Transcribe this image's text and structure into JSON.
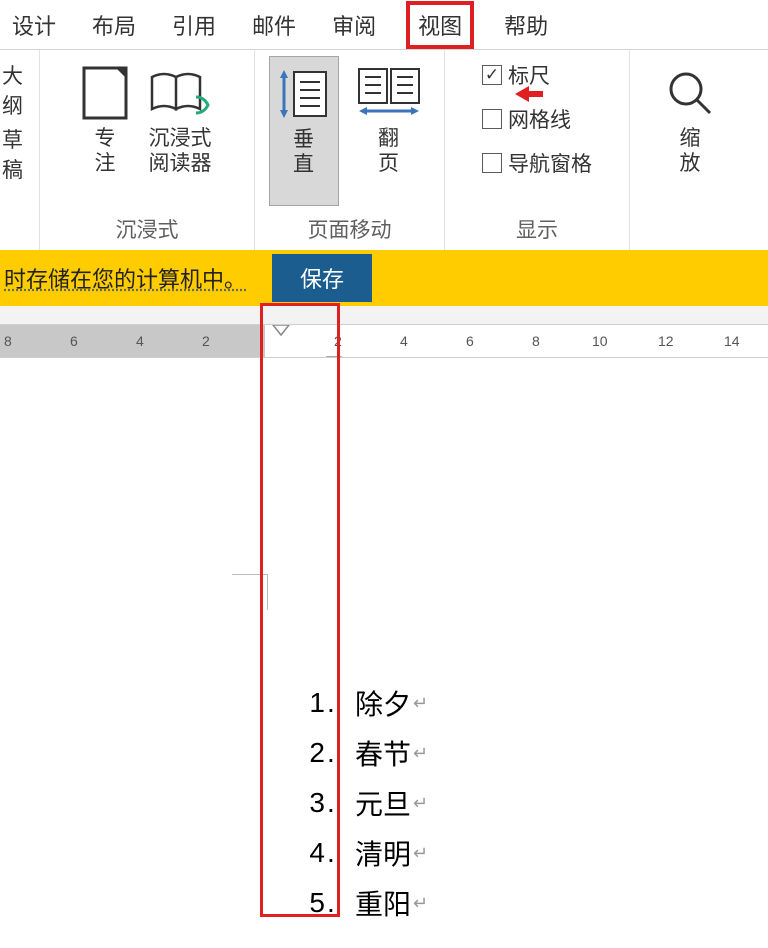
{
  "tabs": {
    "design": "设计",
    "layout": "布局",
    "reference": "引用",
    "mail": "邮件",
    "review": "审阅",
    "view": "视图",
    "help": "帮助"
  },
  "left_clip": {
    "outline": "大纲",
    "draft": "草稿"
  },
  "ribbon": {
    "immersive_group": "沉浸式",
    "focus": "专\n注",
    "reader": "沉浸式\n阅读器",
    "pagemove_group": "页面移动",
    "vertical": "垂\n直",
    "flip": "翻\n页",
    "show_group": "显示",
    "ruler": "标尺",
    "gridlines": "网格线",
    "navpane": "导航窗格",
    "zoom": "缩\n放"
  },
  "msgbar": {
    "text": "时存储在您的计算机中。",
    "save": "保存"
  },
  "ruler_marks": [
    "8",
    "6",
    "4",
    "2",
    "2",
    "4",
    "6",
    "8",
    "10",
    "12",
    "14"
  ],
  "doc": {
    "items": [
      {
        "n": "1",
        "t": "除夕"
      },
      {
        "n": "2",
        "t": "春节"
      },
      {
        "n": "3",
        "t": "元旦"
      },
      {
        "n": "4",
        "t": "清明"
      },
      {
        "n": "5",
        "t": "重阳"
      }
    ]
  }
}
